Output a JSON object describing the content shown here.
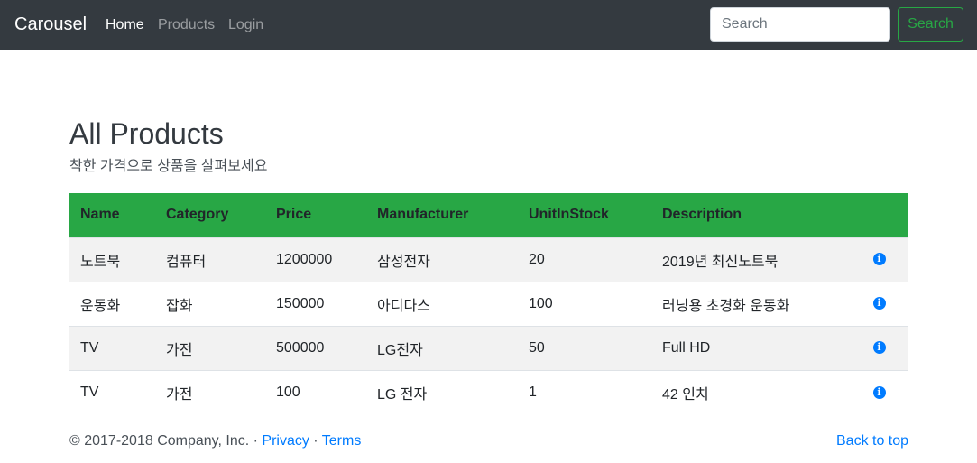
{
  "navbar": {
    "brand": "Carousel",
    "links": [
      {
        "label": "Home",
        "active": true
      },
      {
        "label": "Products",
        "active": false
      },
      {
        "label": "Login",
        "active": false
      }
    ],
    "search_placeholder": "Search",
    "search_button": "Search"
  },
  "main": {
    "title": "All Products",
    "subtitle": "착한 가격으로 상품을 살펴보세요"
  },
  "table": {
    "header_color": "#28a745",
    "columns": [
      "Name",
      "Category",
      "Price",
      "Manufacturer",
      "UnitInStock",
      "Description"
    ],
    "rows": [
      [
        "노트북",
        "컴퓨터",
        "1200000",
        "삼성전자",
        "20",
        "2019년 최신노트북"
      ],
      [
        "운동화",
        "잡화",
        "150000",
        "아디다스",
        "100",
        "러닝용 초경화 운동화"
      ],
      [
        "TV",
        "가전",
        "500000",
        "LG전자",
        "50",
        "Full HD"
      ],
      [
        "TV",
        "가전",
        "100",
        "LG 전자",
        "1",
        "42 인치"
      ]
    ],
    "row_action_icon": "info-circle-icon"
  },
  "footer": {
    "copyright": "© 2017-2018 Company, Inc. · ",
    "privacy": "Privacy",
    "separator": " · ",
    "terms": "Terms",
    "back_to_top": "Back to top"
  }
}
